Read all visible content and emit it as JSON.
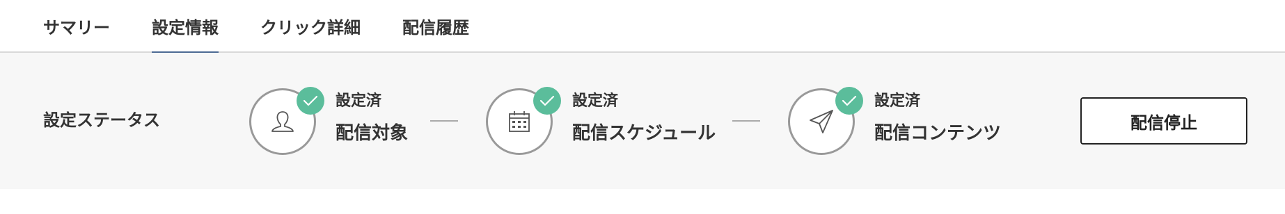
{
  "tabs": [
    {
      "label": "サマリー",
      "active": false
    },
    {
      "label": "設定情報",
      "active": true
    },
    {
      "label": "クリック詳細",
      "active": false
    },
    {
      "label": "配信履歴",
      "active": false
    }
  ],
  "colors": {
    "accent": "#4c6a93",
    "check": "#5bbd9b",
    "panel": "#f7f7f7",
    "circle_border": "#999999"
  },
  "status": {
    "label": "設定ステータス",
    "steps": [
      {
        "status": "設定済",
        "name": "配信対象",
        "icon": "user-icon",
        "completed": true
      },
      {
        "status": "設定済",
        "name": "配信スケジュール",
        "icon": "calendar-icon",
        "completed": true
      },
      {
        "status": "設定済",
        "name": "配信コンテンツ",
        "icon": "paper-plane-icon",
        "completed": true
      }
    ]
  },
  "actions": {
    "stop_label": "配信停止"
  }
}
